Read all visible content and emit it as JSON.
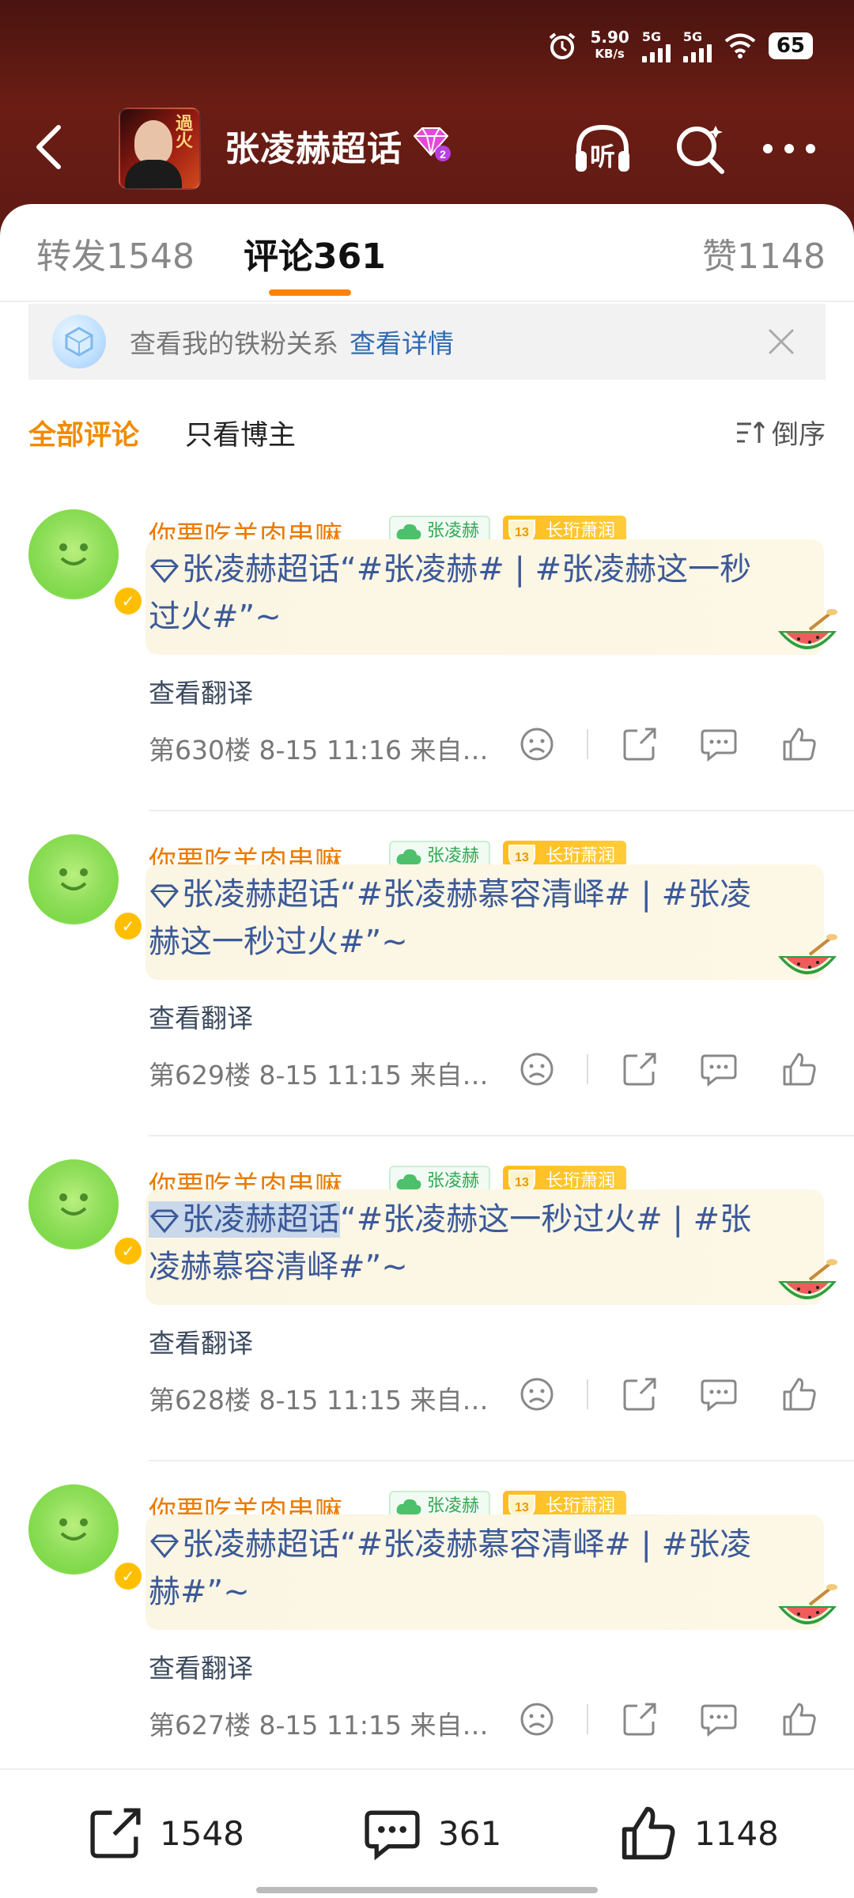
{
  "status_bar": {
    "net_speed_value": "5.90",
    "net_speed_unit": "KB/s",
    "signal_1_label": "5G",
    "signal_2_label": "5G",
    "battery": "65"
  },
  "header": {
    "topic_title": "张凌赫超话",
    "topic_level": "2",
    "cover_text": "過火",
    "listen_label": "听"
  },
  "tabs": [
    {
      "label": "转发",
      "count": "1548"
    },
    {
      "label": "评论",
      "count": "361"
    },
    {
      "label": "赞",
      "count": "1148"
    }
  ],
  "fan_banner": {
    "text": "查看我的铁粉关系",
    "link": "查看详情"
  },
  "filters": {
    "all": "全部评论",
    "blogger_only": "只看博主",
    "sort": "倒序"
  },
  "comments": [
    {
      "username": "你要吃羊肉串嘛_",
      "fan_tag": "张凌赫",
      "level": "13",
      "level_name": "长珩萧润",
      "text_topic": "张凌赫超话",
      "text_rest": "“#张凌赫# | #张凌赫这一秒过火#”~",
      "translate": "查看翻译",
      "floor": "第630楼",
      "time": "8-15 11:16",
      "source": "来自…"
    },
    {
      "username": "你要吃羊肉串嘛_",
      "fan_tag": "张凌赫",
      "level": "13",
      "level_name": "长珩萧润",
      "text_topic": "张凌赫超话",
      "text_rest": "“#张凌赫慕容清峄# | #张凌赫这一秒过火#”~",
      "translate": "查看翻译",
      "floor": "第629楼",
      "time": "8-15 11:15",
      "source": "来自…"
    },
    {
      "username": "你要吃羊肉串嘛_",
      "fan_tag": "张凌赫",
      "level": "13",
      "level_name": "长珩萧润",
      "text_topic": "张凌赫超话",
      "text_rest": "“#张凌赫这一秒过火# | #张凌赫慕容清峄#”~",
      "translate": "查看翻译",
      "floor": "第628楼",
      "time": "8-15 11:15",
      "source": "来自…"
    },
    {
      "username": "你要吃羊肉串嘛_",
      "fan_tag": "张凌赫",
      "level": "13",
      "level_name": "长珩萧润",
      "text_topic": "张凌赫超话",
      "text_rest": "“#张凌赫慕容清峄# | #张凌赫#”~",
      "translate": "查看翻译",
      "floor": "第627楼",
      "time": "8-15 11:15",
      "source": "来自…"
    }
  ],
  "bottom_bar": {
    "repost_count": "1548",
    "comment_count": "361",
    "like_count": "1148"
  },
  "icons": [
    "alarm-icon",
    "signal-icon",
    "wifi-icon",
    "back-icon",
    "diamond-badge-icon",
    "listen-icon",
    "search-icon",
    "more-icon",
    "close-icon",
    "sort-icon",
    "verified-icon",
    "sad-face-icon",
    "share-icon",
    "comment-icon",
    "like-icon",
    "watermelon-sticker-icon"
  ],
  "colors": {
    "header_bg": "#5e1a14",
    "accent_orange": "#ff8200",
    "username": "#eb7b00",
    "topic_link": "#3b5998",
    "fan_link": "#2e6ab3",
    "level_tag": "#ffbd1f",
    "fan_tag_green": "#33a852"
  }
}
